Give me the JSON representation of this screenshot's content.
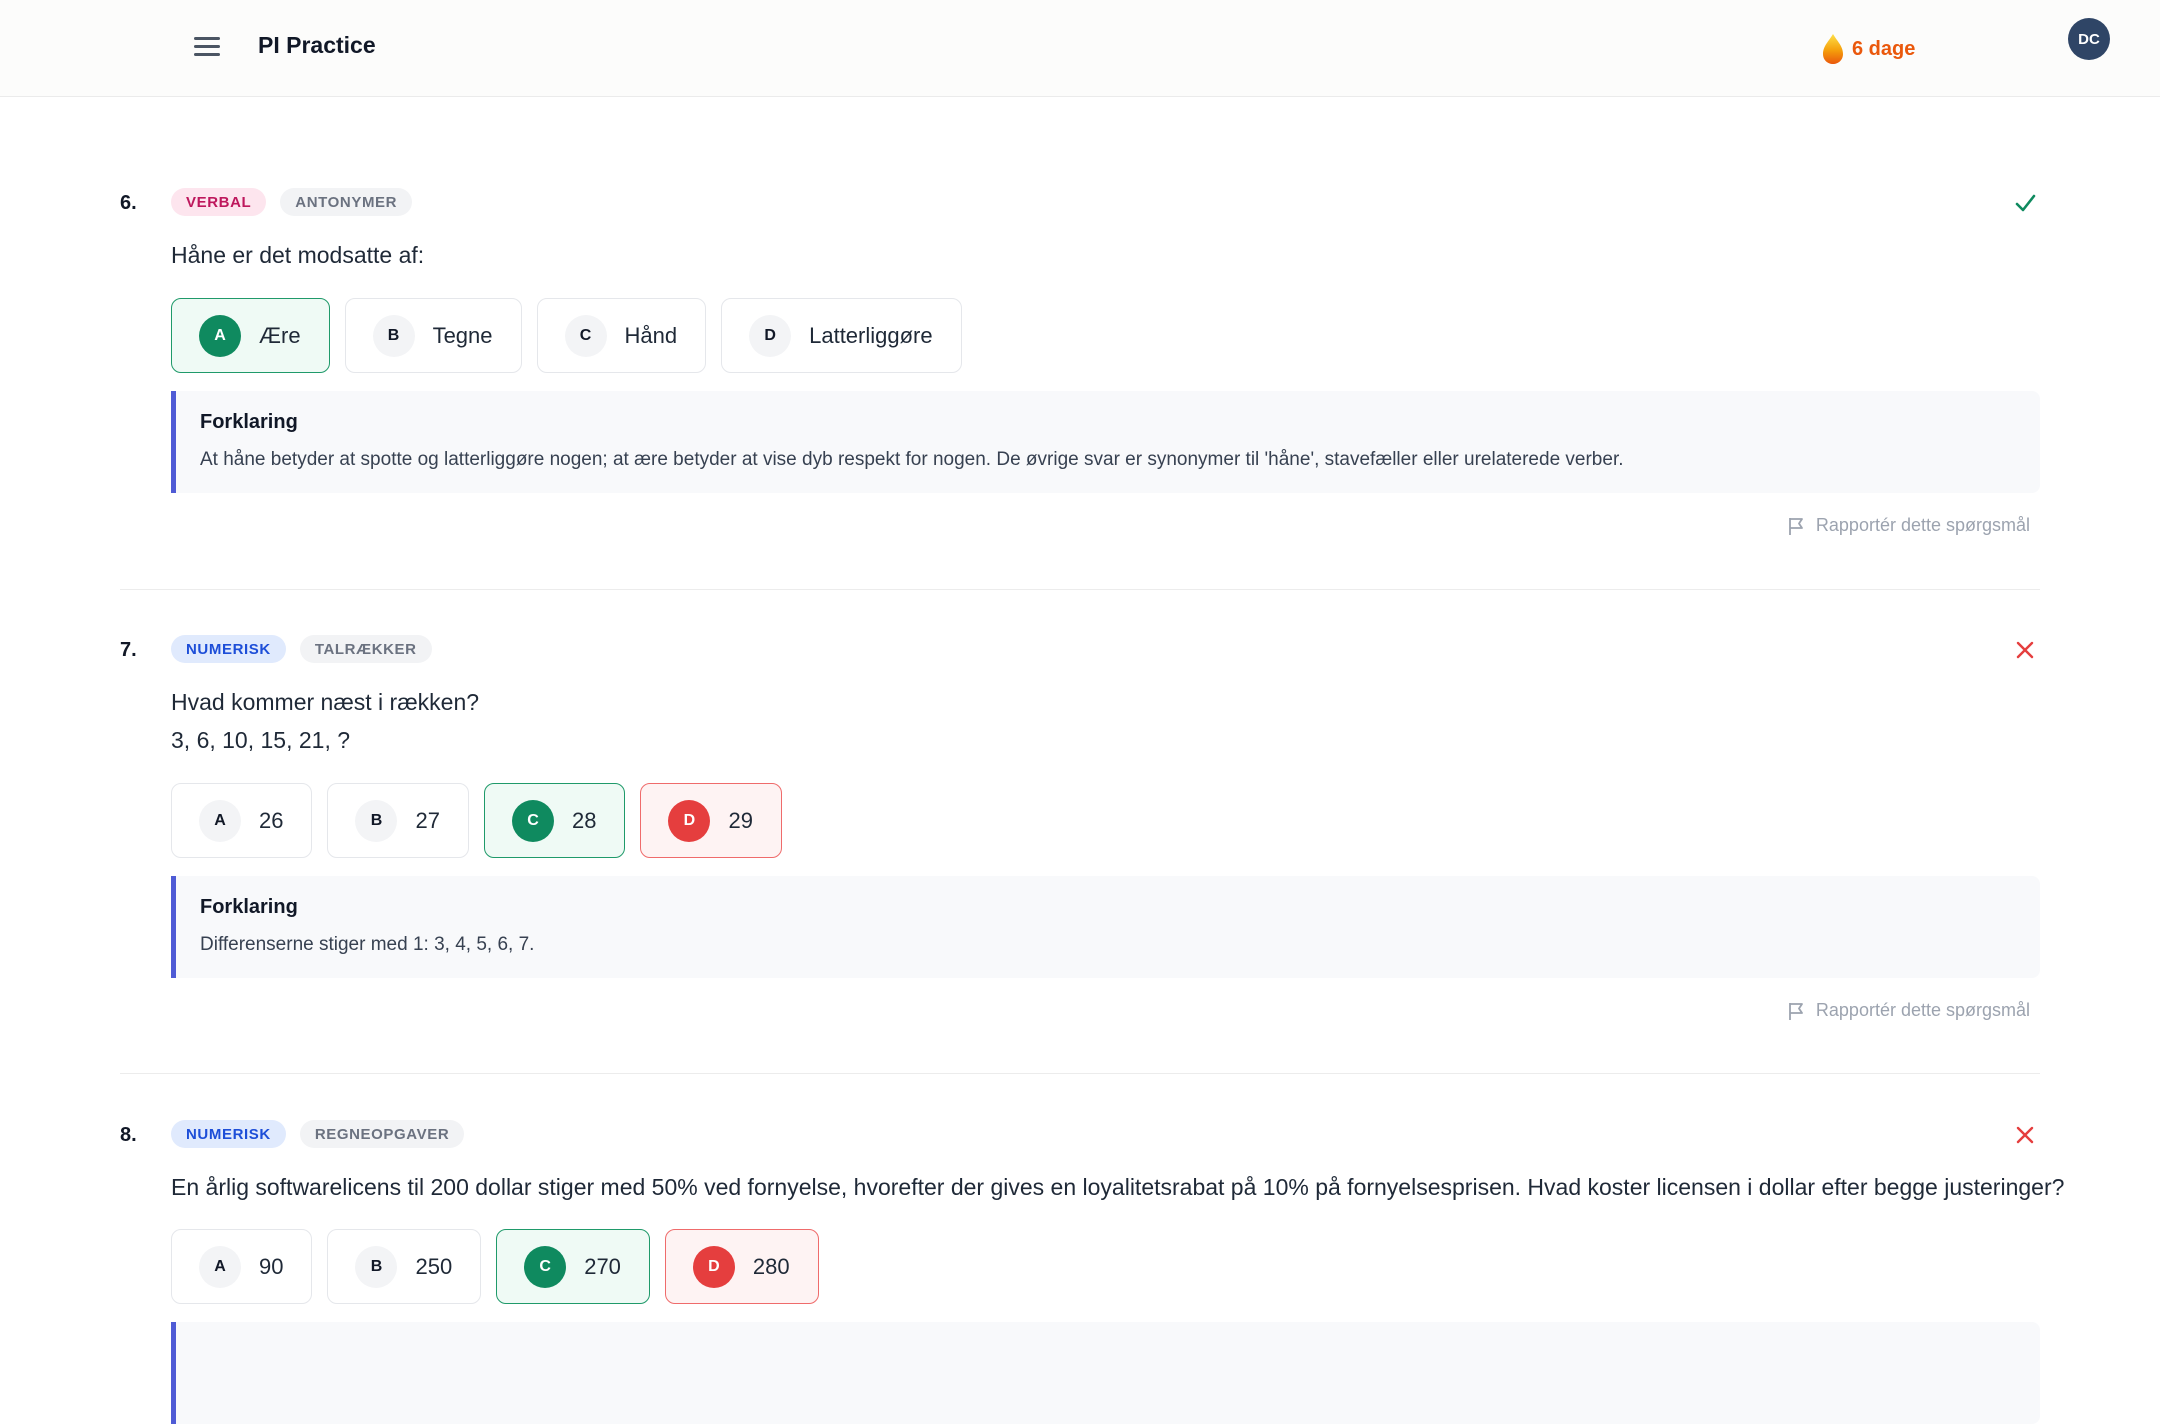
{
  "header": {
    "title": "PI Practice",
    "streak": "6 dage",
    "avatar_initials": "DC"
  },
  "colors": {
    "correct": "#0f8a5f",
    "wrong": "#e53e3e",
    "accent_bar": "#4f5bd5",
    "streak": "#ea580c"
  },
  "questions": [
    {
      "number": "6.",
      "category": "VERBAL",
      "subcategory": "ANTONYMER",
      "status": "correct",
      "status_icon": "check-icon",
      "text": "Håne er det modsatte af:",
      "options": [
        {
          "letter": "A",
          "label": "Ære",
          "state": "correct-selected"
        },
        {
          "letter": "B",
          "label": "Tegne",
          "state": "neutral"
        },
        {
          "letter": "C",
          "label": "Hånd",
          "state": "neutral"
        },
        {
          "letter": "D",
          "label": "Latterliggøre",
          "state": "neutral"
        }
      ],
      "explanation_title": "Forklaring",
      "explanation": "At håne betyder at spotte og latterliggøre nogen; at ære betyder at vise dyb respekt for nogen. De øvrige svar er synonymer til 'håne', stavefæller eller urelaterede verber.",
      "report_label": "Rapportér dette spørgsmål"
    },
    {
      "number": "7.",
      "category": "NUMERISK",
      "subcategory": "TALRÆKKER",
      "status": "wrong",
      "status_icon": "x-icon",
      "text": "Hvad kommer næst i rækken?",
      "text_line2": "3, 6, 10, 15, 21, ?",
      "options": [
        {
          "letter": "A",
          "label": "26",
          "state": "neutral"
        },
        {
          "letter": "B",
          "label": "27",
          "state": "neutral"
        },
        {
          "letter": "C",
          "label": "28",
          "state": "correct"
        },
        {
          "letter": "D",
          "label": "29",
          "state": "wrong-selected"
        }
      ],
      "explanation_title": "Forklaring",
      "explanation": "Differenserne stiger med 1: 3, 4, 5, 6, 7.",
      "report_label": "Rapportér dette spørgsmål"
    },
    {
      "number": "8.",
      "category": "NUMERISK",
      "subcategory": "REGNEOPGAVER",
      "status": "wrong",
      "status_icon": "x-icon",
      "text": "En årlig softwarelicens til 200 dollar stiger med 50% ved fornyelse, hvorefter der gives en loyalitetsrabat på 10% på fornyelsesprisen. Hvad koster licensen i dollar efter begge justeringer?",
      "options": [
        {
          "letter": "A",
          "label": "90",
          "state": "neutral"
        },
        {
          "letter": "B",
          "label": "250",
          "state": "neutral"
        },
        {
          "letter": "C",
          "label": "270",
          "state": "correct"
        },
        {
          "letter": "D",
          "label": "280",
          "state": "wrong-selected"
        }
      ]
    }
  ]
}
